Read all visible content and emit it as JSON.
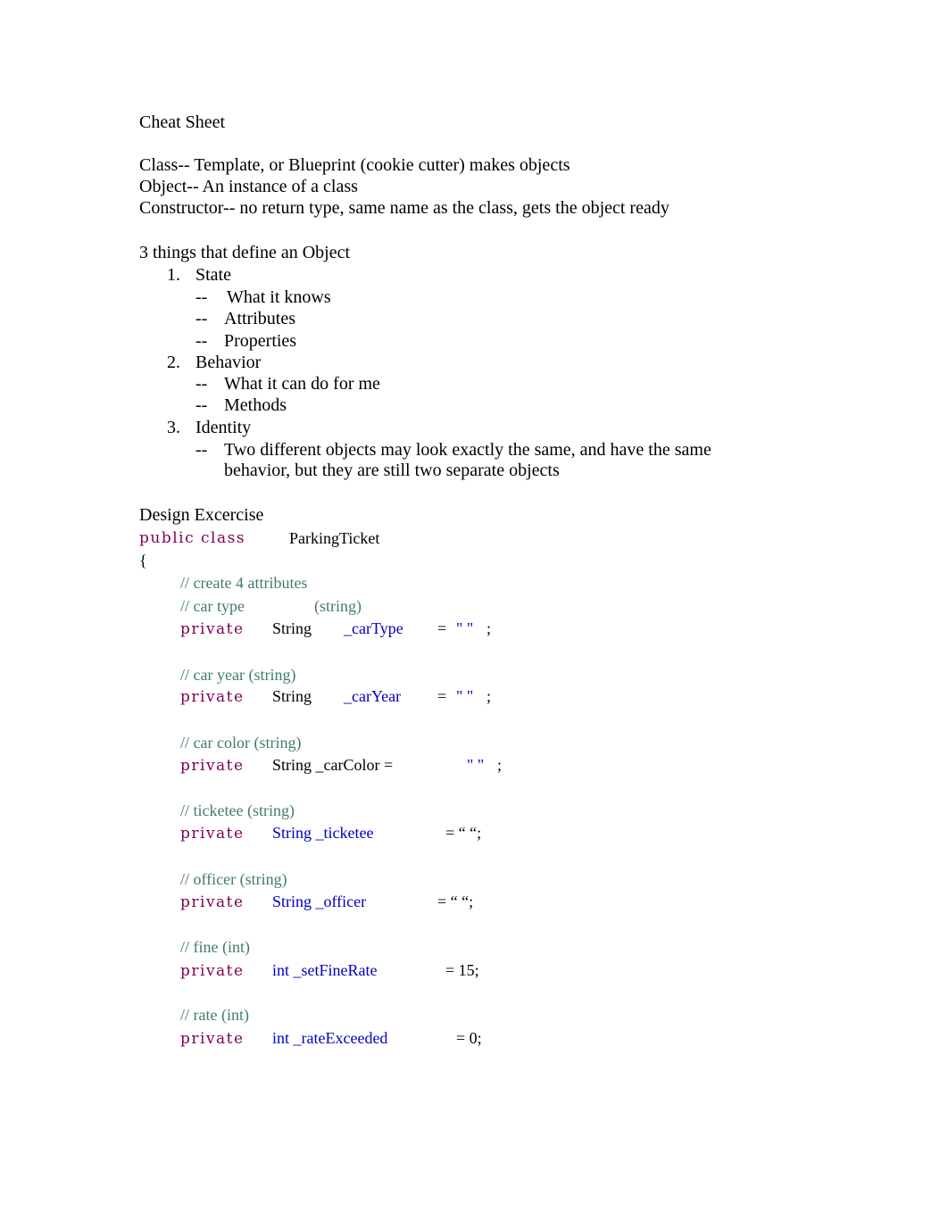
{
  "title": "Cheat Sheet",
  "definitions": [
    "Class-- Template, or Blueprint (cookie cutter) makes objects",
    "Object-- An instance of a class",
    "Constructor-- no return type, same name as the class, gets the object ready"
  ],
  "object_section": {
    "heading": "3 things that define an Object",
    "items": [
      {
        "num": "1.",
        "label": "State",
        "subs": [
          "What it knows",
          "Attributes",
          "Properties"
        ]
      },
      {
        "num": "2.",
        "label": "Behavior",
        "subs": [
          "What it can do for me",
          "Methods"
        ]
      },
      {
        "num": "3.",
        "label": "Identity",
        "subs": [
          "Two different objects may look exactly the same, and have the same",
          "behavior, but they are still two separate objects"
        ]
      }
    ],
    "dash": "--"
  },
  "design": {
    "heading": "Design Excercise",
    "class_kw": "public class",
    "class_name": "ParkingTicket",
    "open_brace": "{",
    "comment_main": "// create 4 attributes",
    "fields": [
      {
        "comment": "// car type",
        "comment_extra": "(string)",
        "kw": "private",
        "type": "String",
        "name": "_carType",
        "eq": "=",
        "value": "\" \"",
        "semi": ";"
      },
      {
        "comment": "// car year (string)",
        "kw": "private",
        "type": "String",
        "name": "_carYear",
        "eq": "=",
        "value": "\" \"",
        "semi": ";"
      },
      {
        "comment": "// car color (string)",
        "kw": "private",
        "decl": "String _carColor =",
        "value": "\" \"",
        "semi": ";"
      },
      {
        "comment": "// ticketee (string)",
        "kw": "private",
        "decl": "String _ticketee",
        "assign": "= “ “;"
      },
      {
        "comment": "// officer (string)",
        "kw": "private",
        "decl": "String _officer",
        "assign": "= “ “;"
      },
      {
        "comment": "// fine (int)",
        "kw": "private",
        "decl": "int _setFineRate",
        "assign": "= 15;"
      },
      {
        "comment": "// rate (int)",
        "kw": "private",
        "decl": "int _rateExceeded",
        "assign": "= 0;"
      }
    ]
  }
}
